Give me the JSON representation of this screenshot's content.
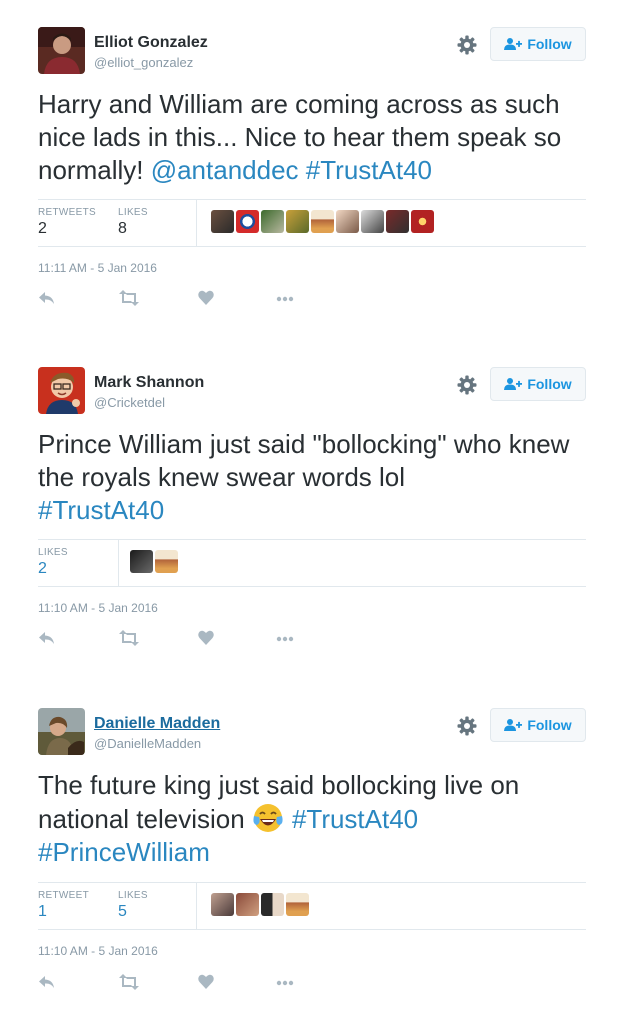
{
  "tweets": [
    {
      "name": "Elliot Gonzalez",
      "handle": "@elliot_gonzalez",
      "follow_label": "Follow",
      "text_plain": "Harry and William are coming across as such nice lads in this... Nice to hear them speak so normally! ",
      "text_mention": "@antanddec",
      "text_hashtag": "#TrustAt40",
      "stat1_label": "RETWEETS",
      "stat1_value": "2",
      "stat2_label": "LIKES",
      "stat2_value": "8",
      "time": "11:11 AM - 5 Jan 2016"
    },
    {
      "name": "Mark Shannon",
      "handle": "@Cricketdel",
      "follow_label": "Follow",
      "text_plain": "Prince William just said \"bollocking\" who knew the royals knew swear words lol",
      "text_hashtag": "#TrustAt40",
      "stat1_label": "LIKES",
      "stat1_value": "2",
      "time": "11:10 AM - 5 Jan 2016"
    },
    {
      "name": "Danielle Madden",
      "handle": "@DanielleMadden",
      "follow_label": "Follow",
      "text_plain": "The future king just said bollocking live on national television",
      "text_hashtag": "#TrustAt40",
      "text_hashtag2": "#PrinceWilliam",
      "stat1_label": "RETWEET",
      "stat1_value": "1",
      "stat2_label": "LIKES",
      "stat2_value": "5",
      "time": "11:10 AM - 5 Jan 2016"
    }
  ],
  "colors": {
    "link": "#2a87c0",
    "follow_text": "#1b95e0",
    "muted": "#8899a6",
    "border": "#e1e8ed"
  }
}
